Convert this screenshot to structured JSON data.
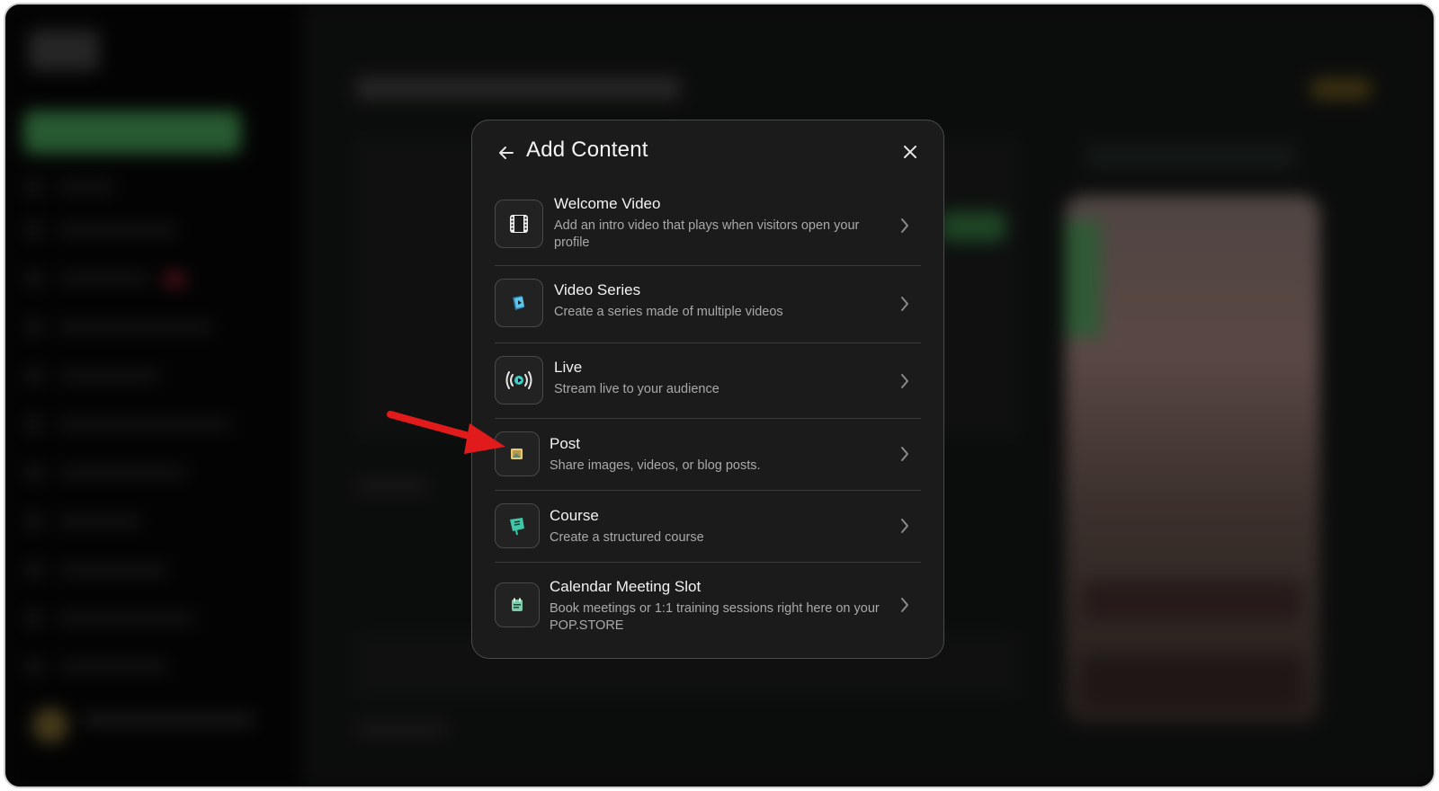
{
  "modal": {
    "title": "Add Content",
    "items": [
      {
        "title": "Welcome Video",
        "description": "Add an intro video that plays when visitors open your profile",
        "icon": "film-icon"
      },
      {
        "title": "Video Series",
        "description": "Create a series made of multiple videos",
        "icon": "video-series-icon"
      },
      {
        "title": "Live",
        "description": "Stream live to your audience",
        "icon": "live-broadcast-icon"
      },
      {
        "title": "Post",
        "description": "Share images, videos, or blog posts.",
        "icon": "post-icon"
      },
      {
        "title": "Course",
        "description": "Create a structured course",
        "icon": "course-icon"
      },
      {
        "title": "Calendar Meeting Slot",
        "description": "Book meetings or 1:1 training sessions right here on your POP.STORE",
        "icon": "calendar-slot-icon"
      }
    ]
  },
  "colors": {
    "modal_bg": "#1b1b1b",
    "modal_border": "#4a4a4a",
    "annotation_arrow": "#e11b1b",
    "background_accent": "#3d8a4c"
  }
}
